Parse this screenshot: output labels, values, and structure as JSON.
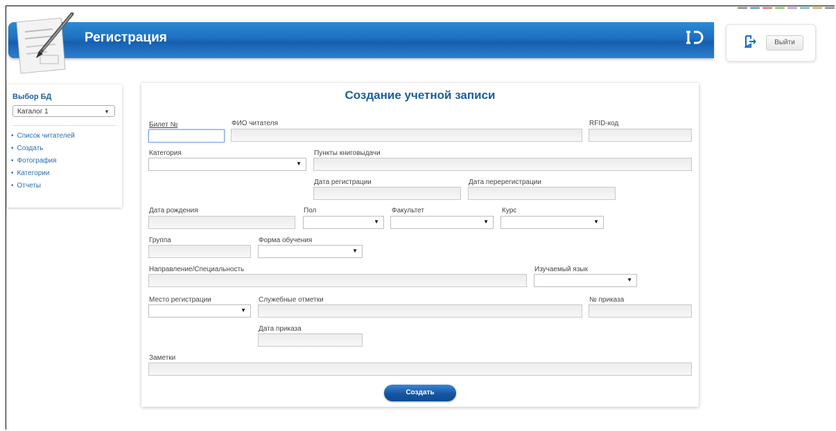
{
  "header": {
    "title": "Регистрация",
    "logo_text": "ID",
    "logout_label": "Выйти"
  },
  "sidebar": {
    "title": "Выбор БД",
    "db_select_value": "Каталог 1",
    "menu": [
      {
        "label": "Список читателей"
      },
      {
        "label": "Создать"
      },
      {
        "label": "Фотография"
      },
      {
        "label": "Категории"
      },
      {
        "label": "Отчеты"
      }
    ]
  },
  "form": {
    "title": "Создание учетной записи",
    "labels": {
      "ticket": "Билет №",
      "fio": "ФИО читателя",
      "rfid": "RFID-код",
      "category": "Категория",
      "issue_points": "Пункты книговыдачи",
      "reg_date": "Дата регистрации",
      "rereg_date": "Дата перерегистрации",
      "birth_date": "Дата рождения",
      "gender": "Пол",
      "faculty": "Факультет",
      "course": "Курс",
      "group": "Группа",
      "study_form": "Форма обучения",
      "direction": "Направление/Специальность",
      "language": "Изучаемый язык",
      "reg_place": "Место регистрации",
      "service_notes": "Служебные отметки",
      "order_no": "№ приказа",
      "order_date": "Дата приказа",
      "notes": "Заметки"
    },
    "submit_label": "Создать"
  },
  "colors": {
    "header_blue": "#1f6fc0",
    "title_blue": "#1a5f9e",
    "link_blue": "#2a6dad"
  }
}
